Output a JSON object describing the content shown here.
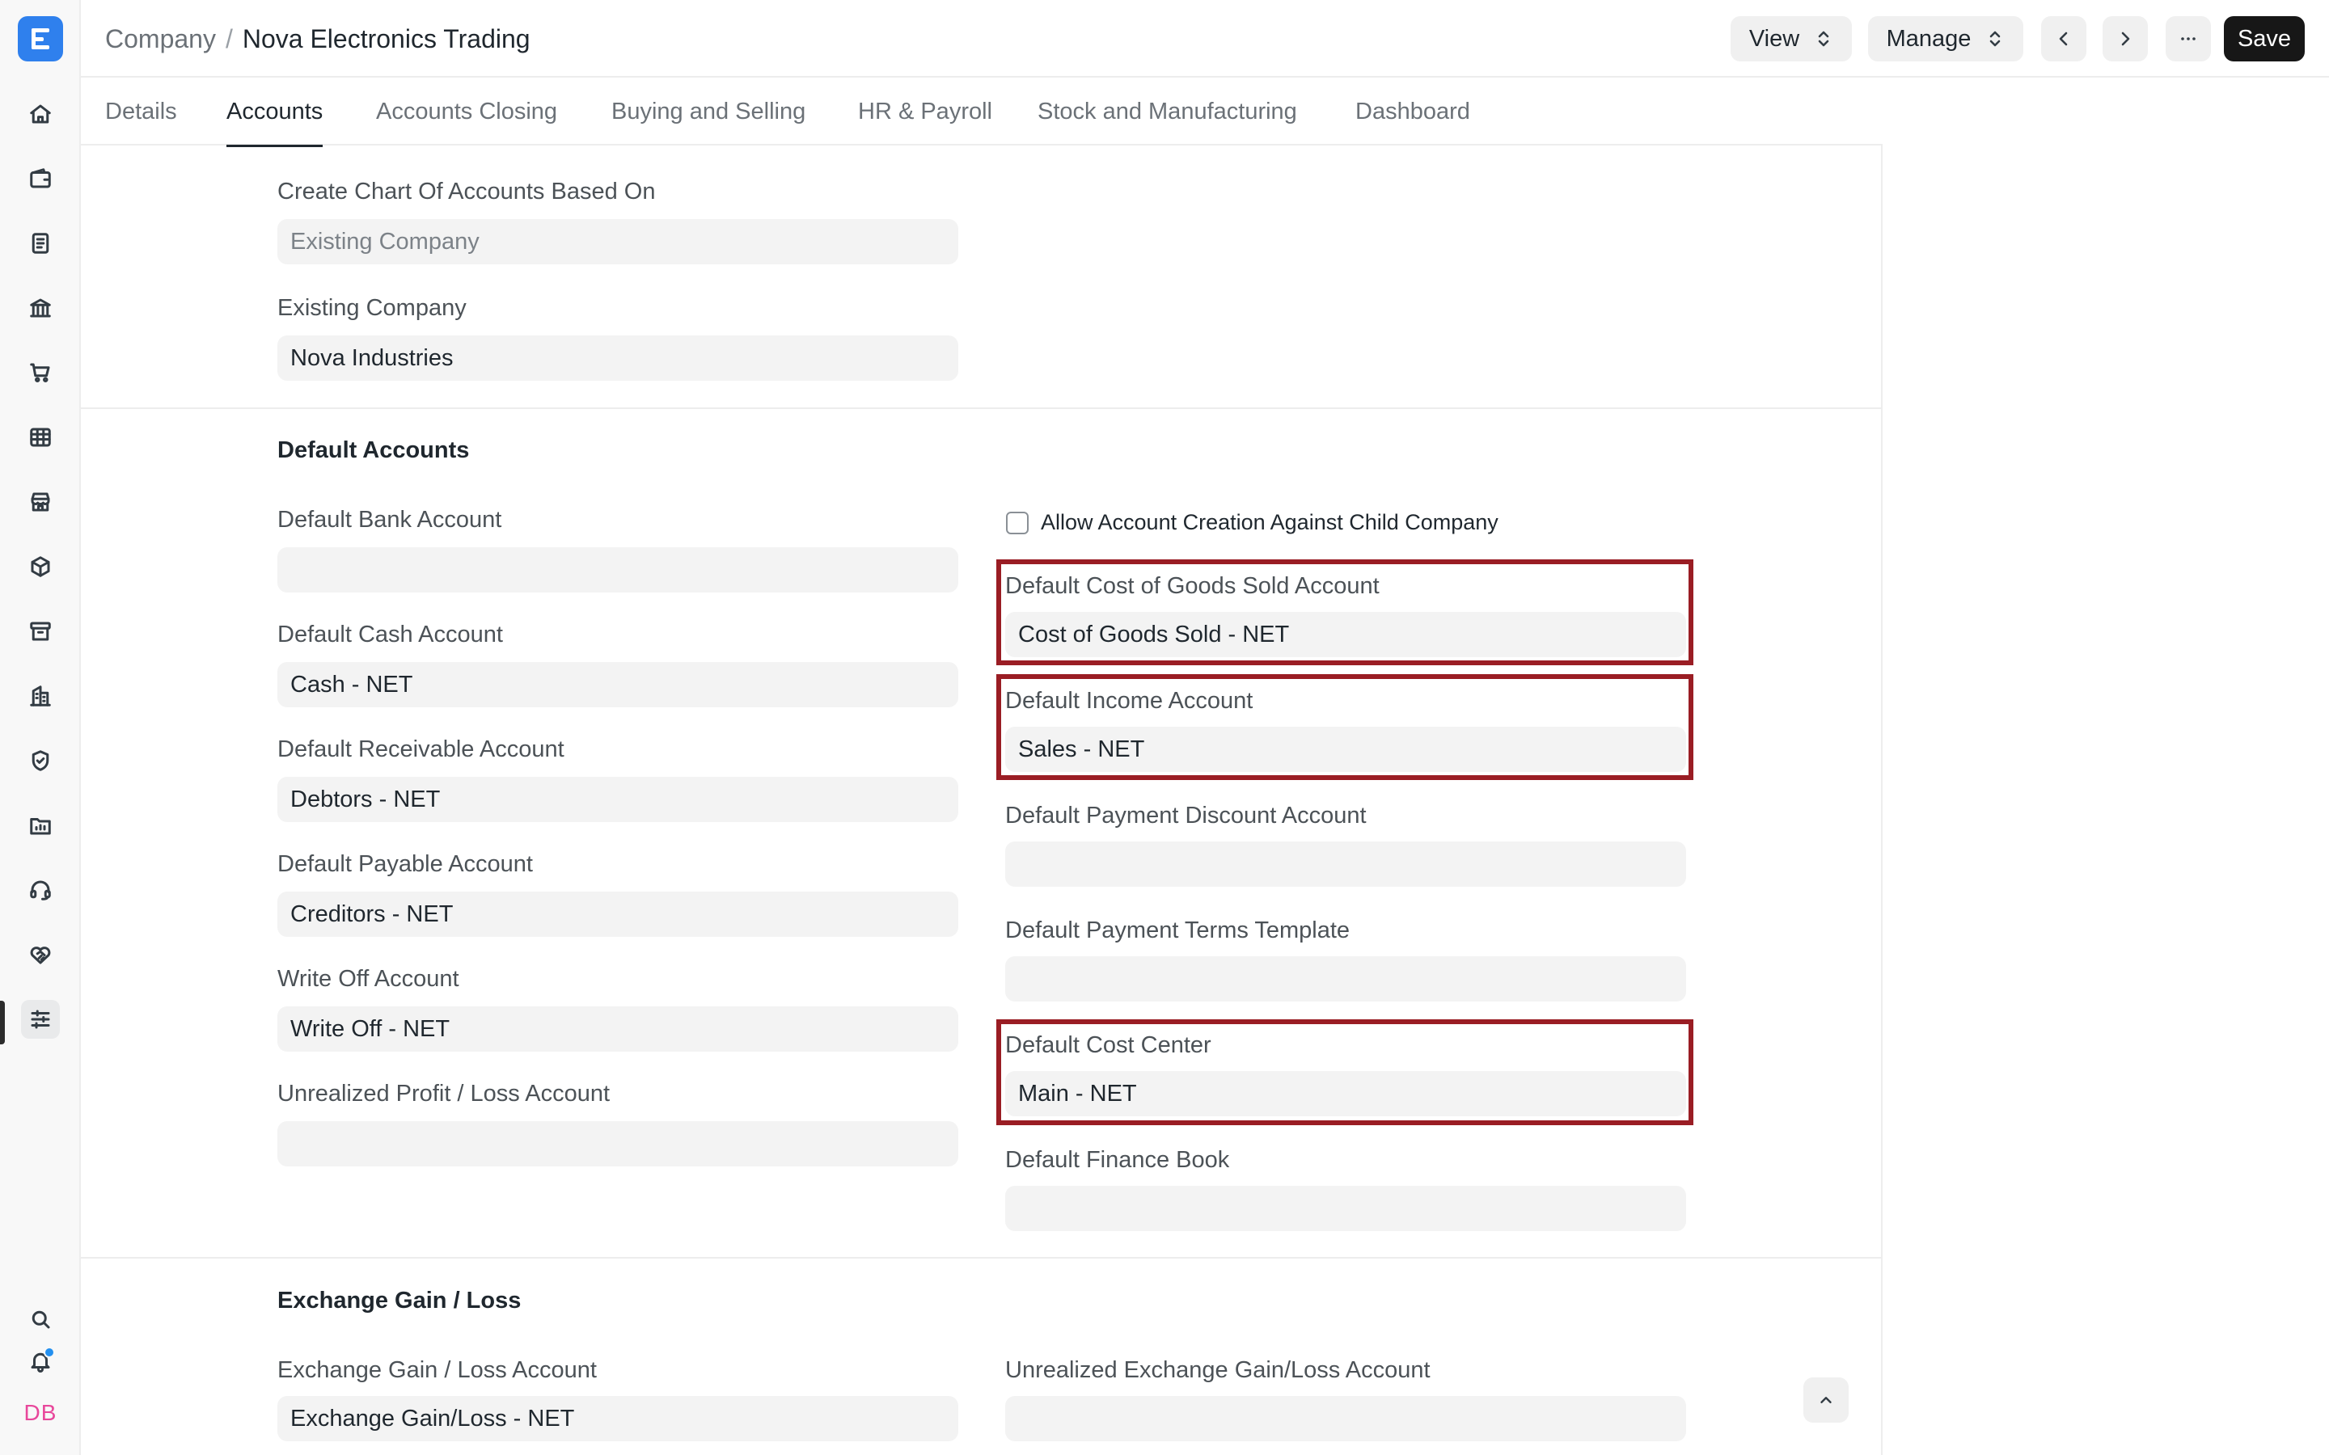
{
  "breadcrumb": {
    "root": "Company",
    "separator": "/",
    "current": "Nova Electronics Trading"
  },
  "header": {
    "view_label": "View",
    "manage_label": "Manage",
    "save_label": "Save"
  },
  "tabs": [
    "Details",
    "Accounts",
    "Accounts Closing",
    "Buying and Selling",
    "HR & Payroll",
    "Stock and Manufacturing",
    "Dashboard"
  ],
  "active_tab": "Accounts",
  "chart_of_accounts": {
    "create_label": "Create Chart Of Accounts Based On",
    "create_value": "Existing Company",
    "existing_label": "Existing Company",
    "existing_value": "Nova Industries"
  },
  "default_accounts": {
    "title": "Default Accounts",
    "left": [
      {
        "label": "Default Bank Account",
        "value": ""
      },
      {
        "label": "Default Cash Account",
        "value": "Cash - NET"
      },
      {
        "label": "Default Receivable Account",
        "value": "Debtors - NET"
      },
      {
        "label": "Default Payable Account",
        "value": "Creditors - NET"
      },
      {
        "label": "Write Off Account",
        "value": "Write Off - NET"
      },
      {
        "label": "Unrealized Profit / Loss Account",
        "value": ""
      }
    ],
    "checkbox_label": "Allow Account Creation Against Child Company",
    "checkbox_checked": false,
    "right": [
      {
        "label": "Default Cost of Goods Sold Account",
        "value": "Cost of Goods Sold - NET"
      },
      {
        "label": "Default Income Account",
        "value": "Sales - NET"
      },
      {
        "label": "Default Payment Discount Account",
        "value": ""
      },
      {
        "label": "Default Payment Terms Template",
        "value": ""
      },
      {
        "label": "Default Cost Center",
        "value": "Main - NET"
      },
      {
        "label": "Default Finance Book",
        "value": ""
      }
    ]
  },
  "exchange": {
    "title": "Exchange Gain / Loss",
    "gain_loss_label": "Exchange Gain / Loss Account",
    "gain_loss_value": "Exchange Gain/Loss - NET",
    "unrealized_label": "Unrealized Exchange Gain/Loss Account",
    "unrealized_value": ""
  },
  "user": {
    "initials": "DB"
  },
  "colors": {
    "accent": "#2f80ed",
    "highlight": "#9a1d24",
    "save_button": "#171717",
    "user_initials": "#e8479b",
    "notification_dot": "#2490ef"
  },
  "sidebar_icons": [
    "home-icon",
    "wallet-icon",
    "receipt-icon",
    "bank-icon",
    "cart-icon",
    "table-icon",
    "store-icon",
    "box-icon",
    "archive-icon",
    "building-icon",
    "shield-icon",
    "folder-chart-icon",
    "headset-icon",
    "handshake-icon",
    "sliders-icon",
    "search-icon",
    "bell-icon"
  ]
}
